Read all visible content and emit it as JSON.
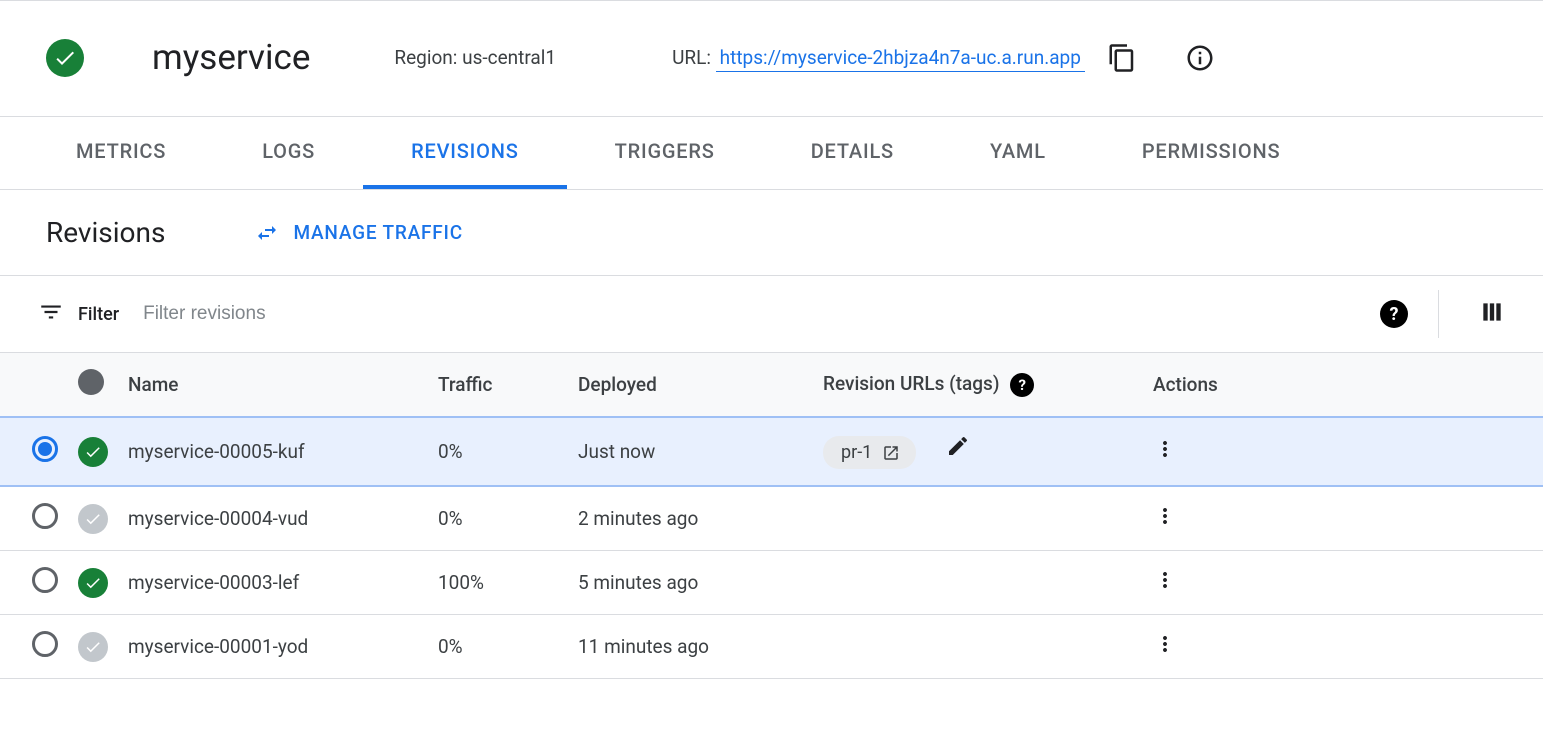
{
  "header": {
    "service_name": "myservice",
    "region_prefix": "Region: ",
    "region": "us-central1",
    "url_prefix": "URL: ",
    "url": "https://myservice-2hbjza4n7a-uc.a.run.app"
  },
  "tabs": [
    {
      "label": "METRICS",
      "active": false
    },
    {
      "label": "LOGS",
      "active": false
    },
    {
      "label": "REVISIONS",
      "active": true
    },
    {
      "label": "TRIGGERS",
      "active": false
    },
    {
      "label": "DETAILS",
      "active": false
    },
    {
      "label": "YAML",
      "active": false
    },
    {
      "label": "PERMISSIONS",
      "active": false
    }
  ],
  "section": {
    "title": "Revisions",
    "manage_traffic": "MANAGE TRAFFIC"
  },
  "filter": {
    "label": "Filter",
    "placeholder": "Filter revisions"
  },
  "table": {
    "columns": {
      "name": "Name",
      "traffic": "Traffic",
      "deployed": "Deployed",
      "tags": "Revision URLs (tags)",
      "actions": "Actions"
    },
    "rows": [
      {
        "selected": true,
        "status": "green",
        "name": "myservice-00005-kuf",
        "traffic": "0%",
        "deployed": "Just now",
        "tag": "pr-1"
      },
      {
        "selected": false,
        "status": "gray",
        "name": "myservice-00004-vud",
        "traffic": "0%",
        "deployed": "2 minutes ago",
        "tag": null
      },
      {
        "selected": false,
        "status": "green",
        "name": "myservice-00003-lef",
        "traffic": "100%",
        "deployed": "5 minutes ago",
        "tag": null
      },
      {
        "selected": false,
        "status": "gray",
        "name": "myservice-00001-yod",
        "traffic": "0%",
        "deployed": "11 minutes ago",
        "tag": null
      }
    ]
  }
}
